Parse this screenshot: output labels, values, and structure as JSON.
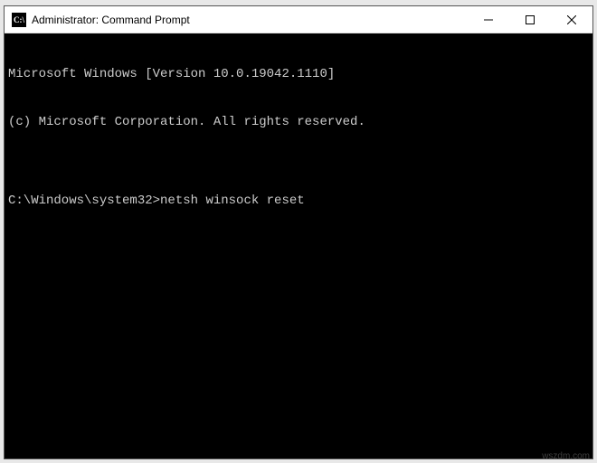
{
  "window": {
    "title": "Administrator: Command Prompt"
  },
  "terminal": {
    "line1": "Microsoft Windows [Version 10.0.19042.1110]",
    "line2": "(c) Microsoft Corporation. All rights reserved.",
    "blank": "",
    "prompt": "C:\\Windows\\system32>",
    "command": "netsh winsock reset"
  },
  "watermark": "wszdm.com"
}
